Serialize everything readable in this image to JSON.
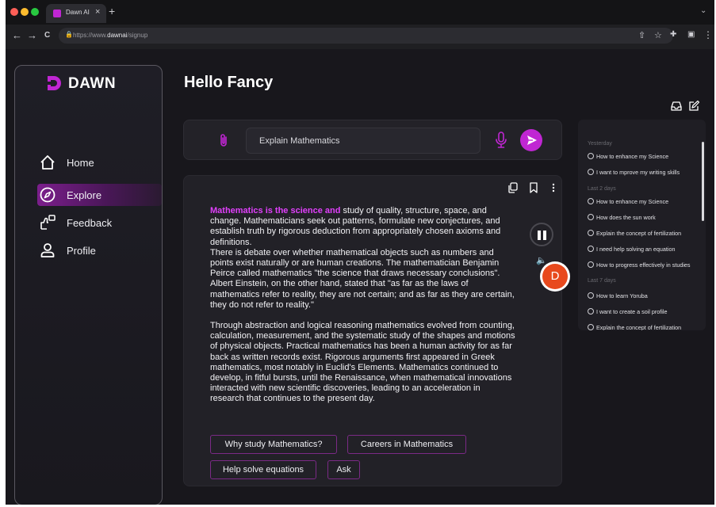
{
  "browser": {
    "tab_title": "Dawn AI",
    "tab_close": "×",
    "new_tab": "+",
    "tabs_menu": "⌄",
    "back": "←",
    "forward": "→",
    "reload": "C",
    "lock": "🔒",
    "url_prefix": "https://www.",
    "url_host": "dawnai",
    "url_path": "/signup",
    "share": "⇧",
    "bookmark": "☆",
    "extensions": "✚",
    "sidepanel": "▣",
    "menu": "⋮"
  },
  "brand": {
    "name": "DAWN",
    "color": "#c026d3"
  },
  "sidebar": {
    "items": [
      {
        "label": "Home",
        "icon": "home-icon",
        "active": false
      },
      {
        "label": "Explore",
        "icon": "compass-icon",
        "active": true
      },
      {
        "label": "Feedback",
        "icon": "feedback-icon",
        "active": false
      },
      {
        "label": "Profile",
        "icon": "user-icon",
        "active": false
      }
    ]
  },
  "main": {
    "greeting": "Hello Fancy",
    "prompt": {
      "value": "Explain Mathematics"
    },
    "answer": {
      "highlight": "Mathematics is the science and",
      "para1_rest": " study of quality, structure, space, and change. Mathematicians seek out patterns, formulate new conjectures, and establish truth by rigorous deduction from appropriately chosen axioms and definitions.\nThere is debate over whether mathematical objects such as numbers and points exist naturally or are human creations. The mathematician Benjamin Peirce called mathematics \"the science that draws necessary conclusions\". Albert Einstein, on the other hand, stated that \"as far as the laws of mathematics refer to reality, they are not certain; and as far as they are certain, they do not refer to reality.\"",
      "para2": "Through abstraction and logical reasoning mathematics evolved from counting, calculation, measurement, and the systematic study of the shapes and motions of physical objects. Practical mathematics has been a human activity for as far back as written records exist. Rigorous arguments first appeared in Greek mathematics, most notably in Euclid's Elements. Mathematics continued to develop, in fitful bursts, until the Renaissance, when mathematical innovations interacted with new scientific discoveries, leading to an acceleration in research that continues to the present day.",
      "speaker": "🔈",
      "avatar_letter": "D"
    },
    "suggestions": [
      "Why study Mathematics?",
      "Careers in Mathematics",
      "Help solve equations",
      "Ask"
    ]
  },
  "history": {
    "groups": [
      {
        "heading": "Yesterday",
        "items": [
          "How to enhance my Science",
          "I want to mprove my writing skills"
        ]
      },
      {
        "heading": "Last 2 days",
        "items": [
          "How to enhance my Science",
          "How does the sun work",
          "Explain the concept of fertilization",
          "I need help solving an equation",
          "How to progress effectively in studies"
        ]
      },
      {
        "heading": "Last 7 days",
        "items": [
          "How to learn Yoruba",
          "I want to create a soil profile",
          "Explain the concept of fertilization"
        ]
      }
    ]
  }
}
